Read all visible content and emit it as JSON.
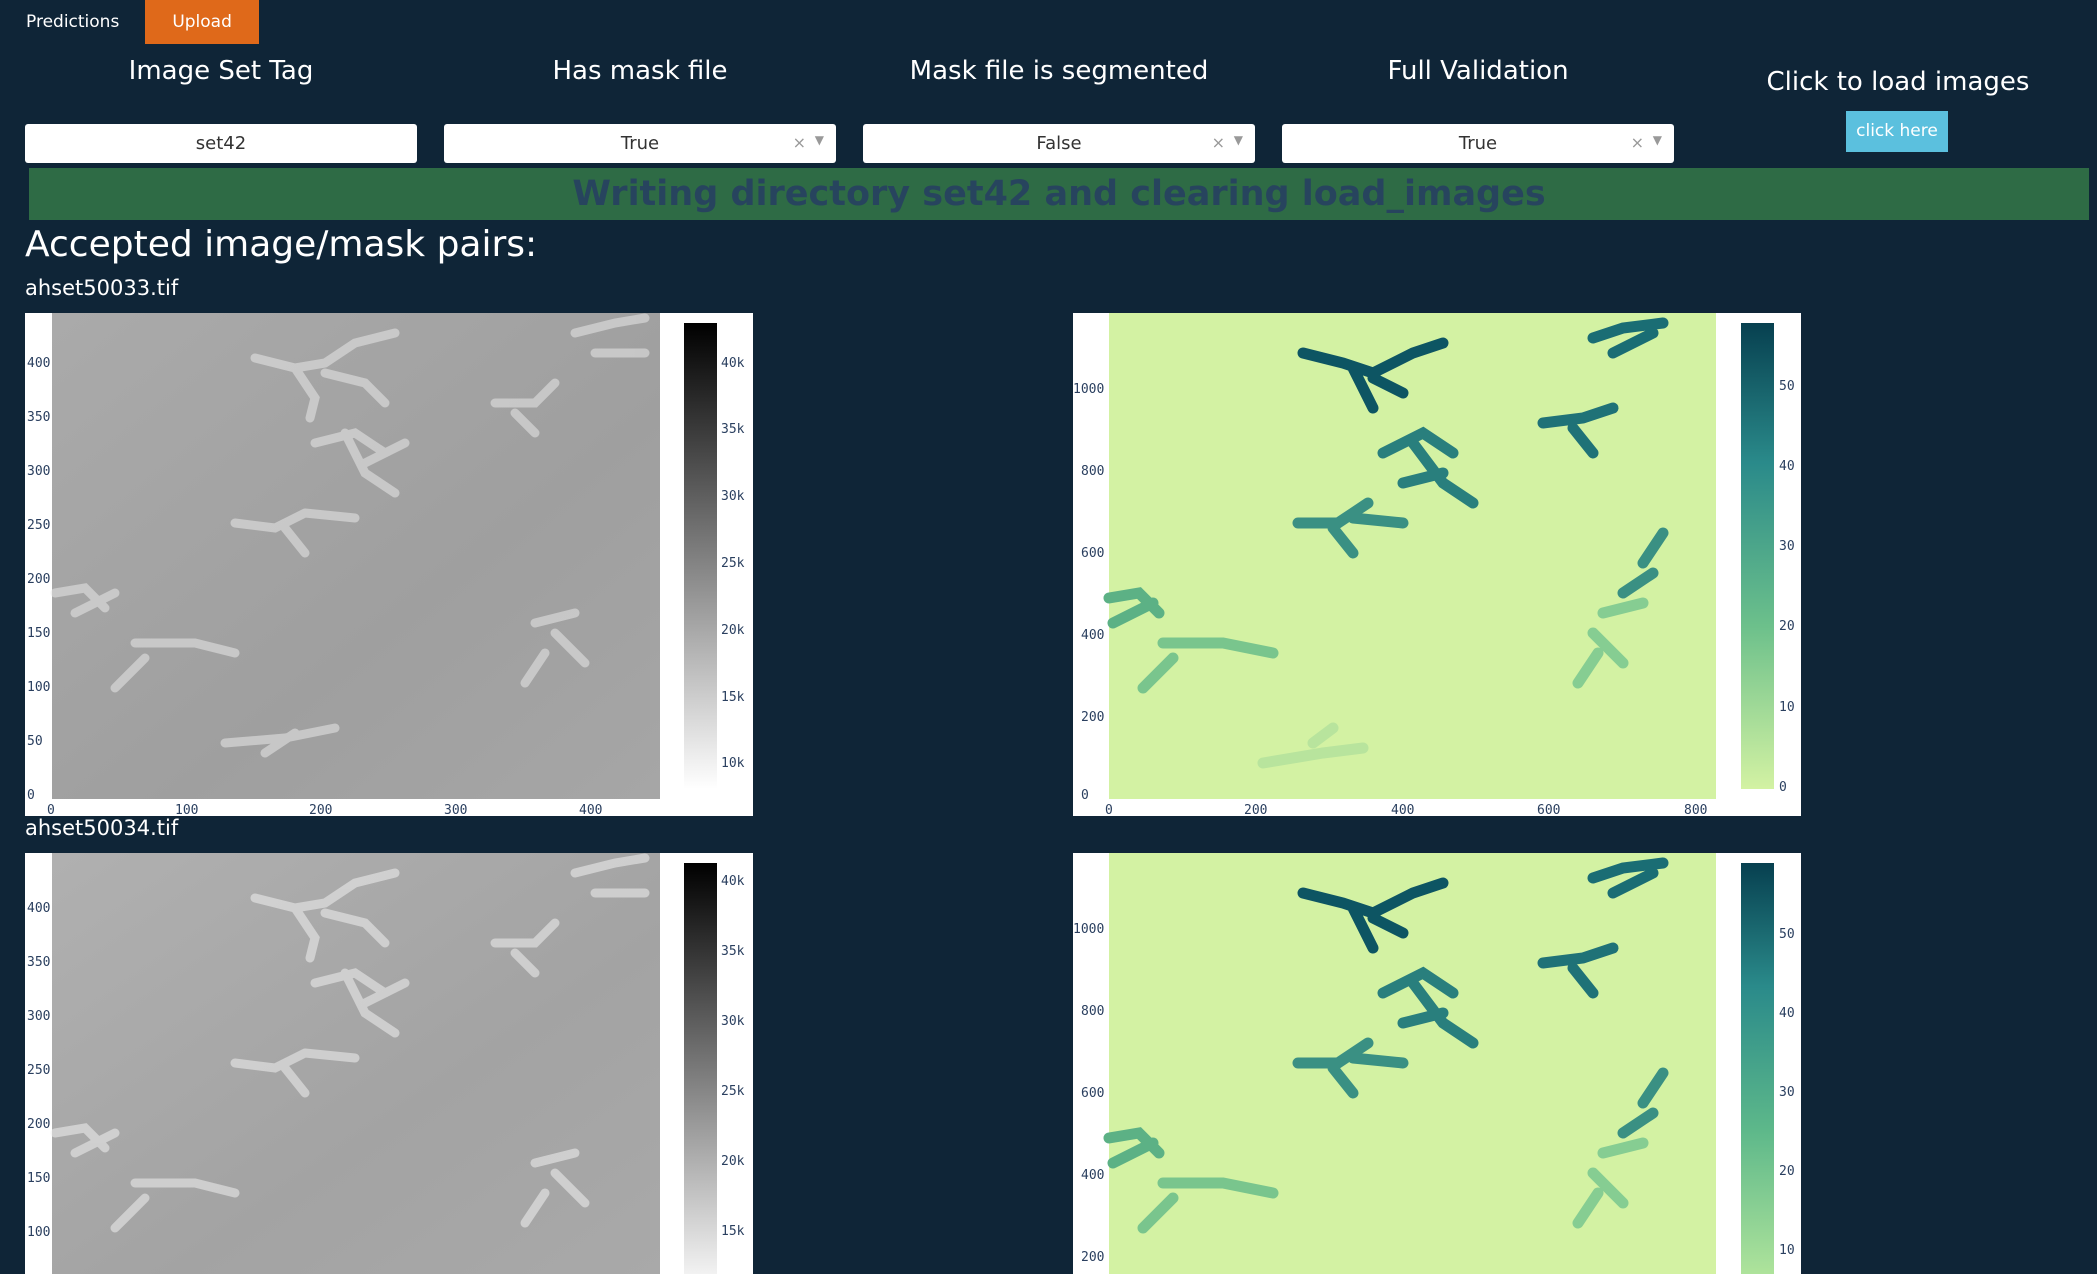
{
  "tabs": [
    {
      "label": "Predictions",
      "active": false
    },
    {
      "label": "Upload",
      "active": true
    }
  ],
  "controls": {
    "image_set_tag": {
      "label": "Image Set Tag",
      "value": "set42"
    },
    "has_mask": {
      "label": "Has mask file",
      "value": "True"
    },
    "mask_segmented": {
      "label": "Mask file is segmented",
      "value": "False"
    },
    "full_validation": {
      "label": "Full Validation",
      "value": "True"
    },
    "load_images": {
      "label": "Click to load images",
      "button": "click here"
    }
  },
  "banner": "Writing directory set42 and clearing load_images",
  "section_title": "Accepted image/mask pairs:",
  "colors": {
    "background": "#0f2537",
    "tab_active": "#df691a",
    "button": "#5bc0de",
    "banner": "#2e6b45",
    "mask_low": "#d3f2a3",
    "mask_high": "#074050"
  },
  "pairs": [
    {
      "filename": "ahset50033.tif",
      "image_plot": {
        "y_ticks": [
          "0",
          "50",
          "100",
          "150",
          "200",
          "250",
          "300",
          "350",
          "400"
        ],
        "x_ticks": [
          "0",
          "100",
          "200",
          "300",
          "400"
        ],
        "colorbar": [
          "10k",
          "15k",
          "20k",
          "25k",
          "30k",
          "35k",
          "40k"
        ]
      },
      "mask_plot": {
        "y_ticks": [
          "0",
          "200",
          "400",
          "600",
          "800",
          "1000"
        ],
        "x_ticks": [
          "0",
          "200",
          "400",
          "600",
          "800"
        ],
        "colorbar": [
          "0",
          "10",
          "20",
          "30",
          "40",
          "50"
        ]
      }
    },
    {
      "filename": "ahset50034.tif",
      "image_plot": {
        "y_ticks": [
          "100",
          "150",
          "200",
          "250",
          "300",
          "350",
          "400"
        ],
        "x_ticks": [],
        "colorbar": [
          "15k",
          "20k",
          "25k",
          "30k",
          "35k",
          "40k"
        ]
      },
      "mask_plot": {
        "y_ticks": [
          "200",
          "400",
          "600",
          "800",
          "1000"
        ],
        "x_ticks": [],
        "colorbar": [
          "10",
          "20",
          "30",
          "40",
          "50"
        ]
      }
    }
  ]
}
